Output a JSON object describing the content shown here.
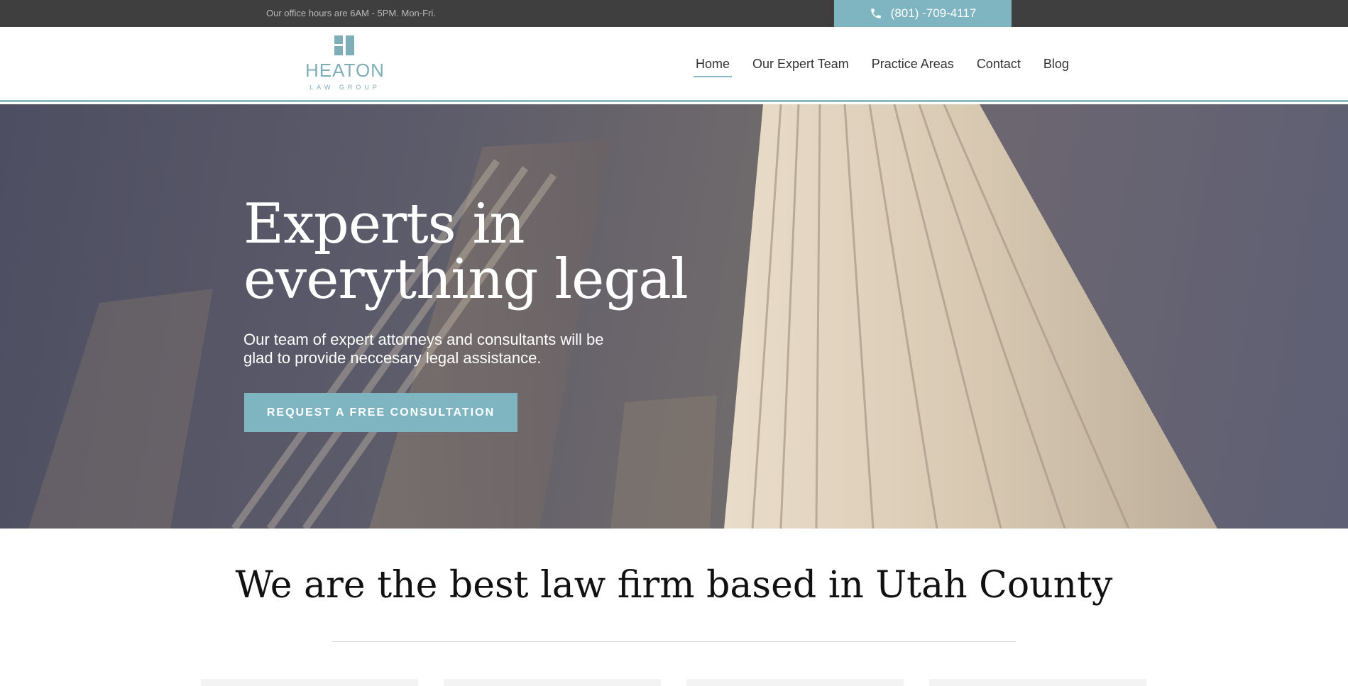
{
  "topbar": {
    "office_hours": "Our office hours are 6AM - 5PM. Mon-Fri.",
    "phone": "(801) -709-4117",
    "phone_icon": "phone-icon"
  },
  "header": {
    "logo": {
      "name": "HEATON",
      "subtitle": "LAW GROUP"
    },
    "nav": [
      {
        "label": "Home",
        "active": true
      },
      {
        "label": "Our Expert Team"
      },
      {
        "label": "Practice Areas"
      },
      {
        "label": "Contact"
      },
      {
        "label": "Blog"
      }
    ]
  },
  "hero": {
    "title_line1": "Experts in",
    "title_line2": "everything legal",
    "subtitle_line1": "Our team of expert attorneys and consultants will be",
    "subtitle_line2": "glad to provide neccesary legal assistance.",
    "cta_label": "REQUEST A FREE CONSULTATION"
  },
  "section": {
    "title": "We are the best law firm based in Utah County"
  },
  "colors": {
    "accent": "#7fb5c1",
    "topbar_bg": "#3f3f3f",
    "text_dark": "#111111"
  }
}
